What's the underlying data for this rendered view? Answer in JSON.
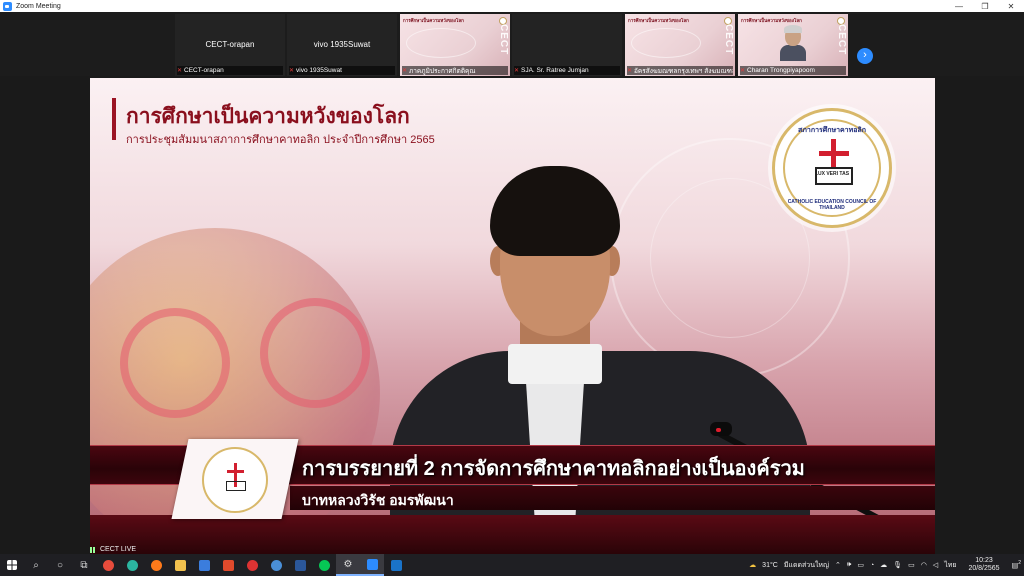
{
  "window": {
    "title": "Zoom Meeting",
    "controls": [
      "—",
      "❐",
      "✕"
    ]
  },
  "gallery": {
    "tiles": [
      {
        "name": "CECT-orapan",
        "caption": "CECT-orapan",
        "kind": "name"
      },
      {
        "name": "vivo 1935Suwat",
        "caption": "vivo 1935Suwat",
        "kind": "name"
      },
      {
        "name": "",
        "caption": "ภาคภูมิประกาศกิตติคุณ",
        "kind": "slide",
        "slide_title": "การศึกษาเป็นความหวังของโลก",
        "brand": "CECT"
      },
      {
        "name": "",
        "caption": "SJA. Sr. Ratree Jumjan",
        "kind": "blank"
      },
      {
        "name": "",
        "caption": "อัครสังฆมณฑลกรุงเทพฯ สังฆมณฑลมุ",
        "kind": "slide",
        "slide_title": "การศึกษาเป็นความหวังของโลก",
        "brand": "CECT"
      },
      {
        "name": "",
        "caption": "Charan Trongpiyapoom",
        "kind": "slide-person",
        "slide_title": "การศึกษาเป็นความหวังของโลก",
        "brand": "CECT"
      }
    ],
    "next_icon": "›"
  },
  "slide": {
    "title": "การศึกษาเป็นความหวังของโลก",
    "subtitle": "การประชุมสัมมนาสภาการศึกษาคาทอลิก ประจำปีการศึกษา 2565",
    "seal_top": "สภาการศึกษาคาทอลิก",
    "seal_bottom": "CATHOLIC EDUCATION COUNCIL OF THAILAND",
    "seal_book": "LUX VERI TAS"
  },
  "lower_third": {
    "headline": "การบรรยายที่ 2 การจัดการศึกษาคาทอลิกอย่างเป็นองค์รวม",
    "speaker": "บาทหลวงวิรัช อมรพัฒนา"
  },
  "live_label": "CECT LIVE",
  "taskbar": {
    "weather": "31°C",
    "weather_text": "มีแดดส่วนใหญ่",
    "lang": "ไทย",
    "time": "10:23",
    "date": "20/8/2565",
    "notification_count": "2"
  }
}
